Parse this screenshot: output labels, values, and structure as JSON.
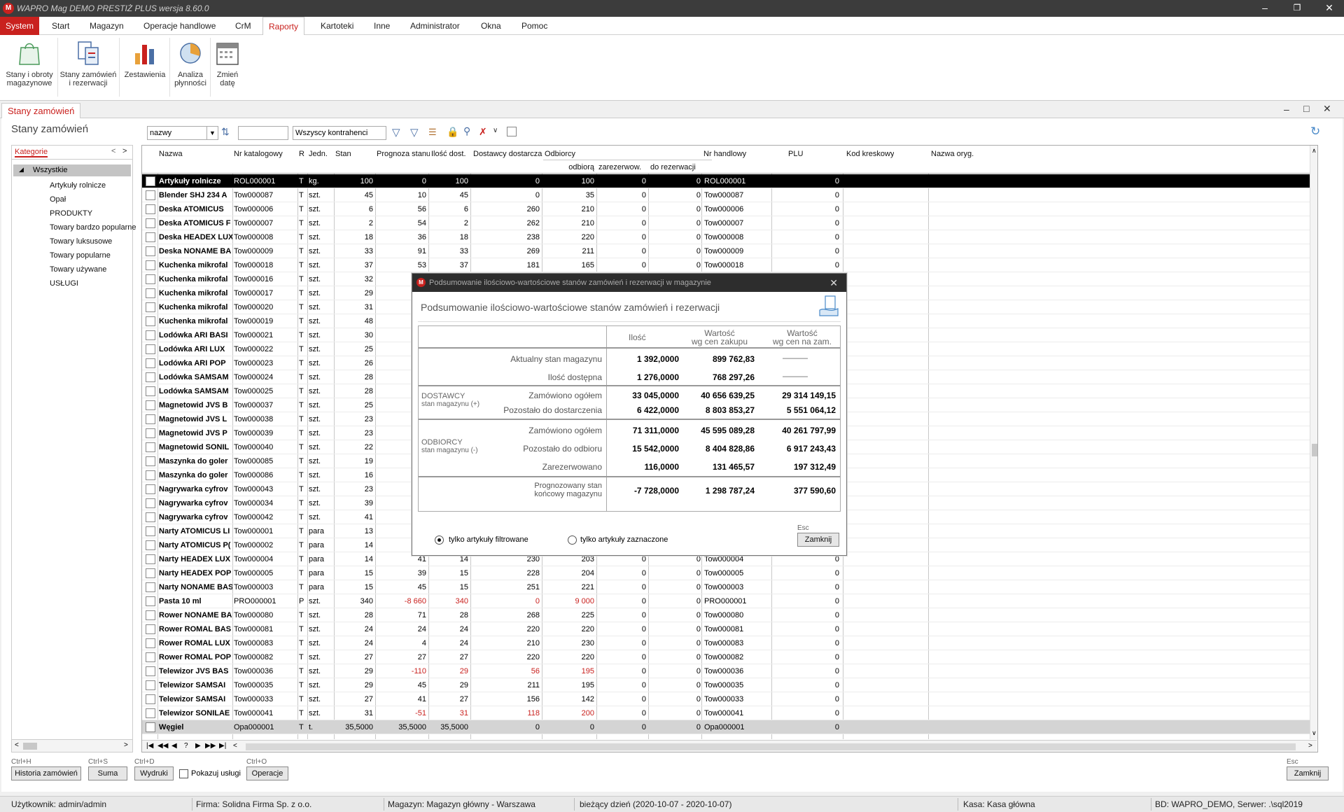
{
  "window": {
    "title": "WAPRO Mag DEMO PRESTIŻ PLUS  wersja 8.60.0"
  },
  "menu": [
    "System",
    "Start",
    "Magazyn",
    "Operacje handlowe",
    "CrM",
    "Raporty",
    "Kartoteki",
    "Inne",
    "Administrator",
    "Okna",
    "Pomoc"
  ],
  "ribbon": [
    {
      "label1": "Stany i obroty",
      "label2": "magazynowe",
      "icon": "shopping-bag-icon"
    },
    {
      "label1": "Stany zamówień",
      "label2": "i rezerwacji",
      "icon": "documents-icon"
    },
    {
      "label1": "Zestawienia",
      "label2": "",
      "icon": "bar-chart-icon"
    },
    {
      "label1": "Analiza",
      "label2": "płynności",
      "icon": "pie-chart-icon"
    },
    {
      "label1": "Zmień",
      "label2": "datę",
      "icon": "calendar-icon"
    }
  ],
  "doc_tab": "Stany zamówień",
  "page_title": "Stany zamówień",
  "filters": {
    "sort_field": "nazwy",
    "search_value": "",
    "contractor": "Wszyscy kontrahenci"
  },
  "categories": {
    "tab": "Kategorie",
    "root": "Wszystkie",
    "items": [
      "Artykuły rolnicze",
      "Opał",
      "PRODUKTY",
      "Towary bardzo popularne",
      "Towary luksusowe",
      "Towary popularne",
      "Towary używane",
      "USŁUGI"
    ]
  },
  "grid": {
    "headers": {
      "nazwa": "Nazwa",
      "nr_kat": "Nr katalogowy",
      "r": "R",
      "jedn": "Jedn.",
      "stan": "Stan",
      "prognoza": "Prognoza stanu",
      "ilosc_dost": "Ilość dost.",
      "dostawcy": "Dostawcy dostarcza",
      "odbiorcy": "Odbiorcy",
      "odbiora": "odbiorą",
      "zarezerwow": "zarezerwow.",
      "do_rezerwacji": "do rezerwacji",
      "nr_handlowy": "Nr handlowy",
      "plu": "PLU",
      "kod": "Kod kreskowy",
      "nazwa_oryg": "Nazwa oryg."
    },
    "rows": [
      {
        "n": "Artykuły rolnicze",
        "k": "ROL000001",
        "r": "T",
        "j": "kg.",
        "s": "100",
        "p": "0",
        "i": "100",
        "d": "0",
        "o": "100",
        "z": "0",
        "dr": "0",
        "h": "ROL000001",
        "plu": "0",
        "sel": true
      },
      {
        "n": "Blender SHJ 234 A",
        "k": "Tow000087",
        "r": "T",
        "j": "szt.",
        "s": "45",
        "p": "10",
        "i": "45",
        "d": "0",
        "o": "35",
        "z": "0",
        "dr": "0",
        "h": "Tow000087",
        "plu": "0"
      },
      {
        "n": "Deska ATOMICUS",
        "k": "Tow000006",
        "r": "T",
        "j": "szt.",
        "s": "6",
        "p": "56",
        "i": "6",
        "d": "260",
        "o": "210",
        "z": "0",
        "dr": "0",
        "h": "Tow000006",
        "plu": "0"
      },
      {
        "n": "Deska ATOMICUS F",
        "k": "Tow000007",
        "r": "T",
        "j": "szt.",
        "s": "2",
        "p": "54",
        "i": "2",
        "d": "262",
        "o": "210",
        "z": "0",
        "dr": "0",
        "h": "Tow000007",
        "plu": "0"
      },
      {
        "n": "Deska HEADEX LUX",
        "k": "Tow000008",
        "r": "T",
        "j": "szt.",
        "s": "18",
        "p": "36",
        "i": "18",
        "d": "238",
        "o": "220",
        "z": "0",
        "dr": "0",
        "h": "Tow000008",
        "plu": "0"
      },
      {
        "n": "Deska NONAME BA",
        "k": "Tow000009",
        "r": "T",
        "j": "szt.",
        "s": "33",
        "p": "91",
        "i": "33",
        "d": "269",
        "o": "211",
        "z": "0",
        "dr": "0",
        "h": "Tow000009",
        "plu": "0"
      },
      {
        "n": "Kuchenka mikrofal",
        "k": "Tow000018",
        "r": "T",
        "j": "szt.",
        "s": "37",
        "p": "53",
        "i": "37",
        "d": "181",
        "o": "165",
        "z": "0",
        "dr": "0",
        "h": "Tow000018",
        "plu": "0"
      },
      {
        "n": "Kuchenka mikrofal",
        "k": "Tow000016",
        "r": "T",
        "j": "szt.",
        "s": "32",
        "p": "",
        "i": "",
        "d": "",
        "o": "",
        "z": "",
        "dr": "",
        "h": "",
        "plu": ""
      },
      {
        "n": "Kuchenka mikrofal",
        "k": "Tow000017",
        "r": "T",
        "j": "szt.",
        "s": "29",
        "p": "",
        "i": "",
        "d": "",
        "o": "",
        "z": "",
        "dr": "",
        "h": "",
        "plu": ""
      },
      {
        "n": "Kuchenka mikrofal",
        "k": "Tow000020",
        "r": "T",
        "j": "szt.",
        "s": "31",
        "p": "",
        "i": "",
        "d": "",
        "o": "",
        "z": "",
        "dr": "",
        "h": "",
        "plu": ""
      },
      {
        "n": "Kuchenka mikrofal",
        "k": "Tow000019",
        "r": "T",
        "j": "szt.",
        "s": "48",
        "p": "",
        "i": "",
        "d": "",
        "o": "",
        "z": "",
        "dr": "",
        "h": "",
        "plu": ""
      },
      {
        "n": "Lodówka ARI BASI",
        "k": "Tow000021",
        "r": "T",
        "j": "szt.",
        "s": "30",
        "p": "",
        "i": "",
        "d": "",
        "o": "",
        "z": "",
        "dr": "",
        "h": "",
        "plu": ""
      },
      {
        "n": "Lodówka ARI LUX",
        "k": "Tow000022",
        "r": "T",
        "j": "szt.",
        "s": "25",
        "p": "",
        "i": "",
        "d": "",
        "o": "",
        "z": "",
        "dr": "",
        "h": "",
        "plu": ""
      },
      {
        "n": "Lodówka ARI POP",
        "k": "Tow000023",
        "r": "T",
        "j": "szt.",
        "s": "26",
        "p": "",
        "i": "",
        "d": "",
        "o": "",
        "z": "",
        "dr": "",
        "h": "",
        "plu": ""
      },
      {
        "n": "Lodówka SAMSAM",
        "k": "Tow000024",
        "r": "T",
        "j": "szt.",
        "s": "28",
        "p": "",
        "i": "",
        "d": "",
        "o": "",
        "z": "",
        "dr": "",
        "h": "",
        "plu": ""
      },
      {
        "n": "Lodówka SAMSAM",
        "k": "Tow000025",
        "r": "T",
        "j": "szt.",
        "s": "28",
        "p": "",
        "i": "",
        "d": "",
        "o": "",
        "z": "",
        "dr": "",
        "h": "",
        "plu": ""
      },
      {
        "n": "Magnetowid JVS B",
        "k": "Tow000037",
        "r": "T",
        "j": "szt.",
        "s": "25",
        "p": "",
        "i": "",
        "d": "",
        "o": "",
        "z": "",
        "dr": "",
        "h": "",
        "plu": ""
      },
      {
        "n": "Magnetowid JVS L",
        "k": "Tow000038",
        "r": "T",
        "j": "szt.",
        "s": "23",
        "p": "",
        "i": "",
        "d": "",
        "o": "",
        "z": "",
        "dr": "",
        "h": "",
        "plu": ""
      },
      {
        "n": "Magnetowid JVS P",
        "k": "Tow000039",
        "r": "T",
        "j": "szt.",
        "s": "23",
        "p": "",
        "i": "",
        "d": "",
        "o": "",
        "z": "",
        "dr": "",
        "h": "",
        "plu": ""
      },
      {
        "n": "Magnetowid SONIL",
        "k": "Tow000040",
        "r": "T",
        "j": "szt.",
        "s": "22",
        "p": "",
        "i": "",
        "d": "",
        "o": "",
        "z": "",
        "dr": "",
        "h": "",
        "plu": ""
      },
      {
        "n": "Maszynka do goler",
        "k": "Tow000085",
        "r": "T",
        "j": "szt.",
        "s": "19",
        "p": "",
        "i": "",
        "d": "",
        "o": "",
        "z": "",
        "dr": "",
        "h": "",
        "plu": ""
      },
      {
        "n": "Maszynka do goler",
        "k": "Tow000086",
        "r": "T",
        "j": "szt.",
        "s": "16",
        "p": "",
        "i": "",
        "d": "",
        "o": "",
        "z": "",
        "dr": "",
        "h": "",
        "plu": ""
      },
      {
        "n": "Nagrywarka cyfrov",
        "k": "Tow000043",
        "r": "T",
        "j": "szt.",
        "s": "23",
        "p": "",
        "i": "",
        "d": "",
        "o": "",
        "z": "",
        "dr": "",
        "h": "",
        "plu": ""
      },
      {
        "n": "Nagrywarka cyfrov",
        "k": "Tow000034",
        "r": "T",
        "j": "szt.",
        "s": "39",
        "p": "",
        "i": "",
        "d": "",
        "o": "",
        "z": "",
        "dr": "",
        "h": "",
        "plu": ""
      },
      {
        "n": "Nagrywarka cyfrov",
        "k": "Tow000042",
        "r": "T",
        "j": "szt.",
        "s": "41",
        "p": "",
        "i": "",
        "d": "",
        "o": "",
        "z": "",
        "dr": "",
        "h": "",
        "plu": ""
      },
      {
        "n": "Narty ATOMICUS LI",
        "k": "Tow000001",
        "r": "T",
        "j": "para",
        "s": "13",
        "p": "",
        "i": "",
        "d": "",
        "o": "",
        "z": "",
        "dr": "",
        "h": "",
        "plu": ""
      },
      {
        "n": "Narty ATOMICUS P(",
        "k": "Tow000002",
        "r": "T",
        "j": "para",
        "s": "14",
        "p": "",
        "i": "",
        "d": "",
        "o": "",
        "z": "",
        "dr": "",
        "h": "",
        "plu": ""
      },
      {
        "n": "Narty HEADEX LUX",
        "k": "Tow000004",
        "r": "T",
        "j": "para",
        "s": "14",
        "p": "41",
        "i": "14",
        "d": "230",
        "o": "203",
        "z": "0",
        "dr": "0",
        "h": "Tow000004",
        "plu": "0"
      },
      {
        "n": "Narty HEADEX POP",
        "k": "Tow000005",
        "r": "T",
        "j": "para",
        "s": "15",
        "p": "39",
        "i": "15",
        "d": "228",
        "o": "204",
        "z": "0",
        "dr": "0",
        "h": "Tow000005",
        "plu": "0"
      },
      {
        "n": "Narty NONAME BAS",
        "k": "Tow000003",
        "r": "T",
        "j": "para",
        "s": "15",
        "p": "45",
        "i": "15",
        "d": "251",
        "o": "221",
        "z": "0",
        "dr": "0",
        "h": "Tow000003",
        "plu": "0"
      },
      {
        "n": "Pasta 10 ml",
        "k": "PRO000001",
        "r": "P",
        "j": "szt.",
        "s": "340",
        "p": "-8 660",
        "i": "340",
        "d": "0",
        "o": "9 000",
        "z": "0",
        "dr": "0",
        "h": "PRO000001",
        "plu": "0",
        "red": true
      },
      {
        "n": "Rower NONAME BA",
        "k": "Tow000080",
        "r": "T",
        "j": "szt.",
        "s": "28",
        "p": "71",
        "i": "28",
        "d": "268",
        "o": "225",
        "z": "0",
        "dr": "0",
        "h": "Tow000080",
        "plu": "0"
      },
      {
        "n": "Rower ROMAL BAS",
        "k": "Tow000081",
        "r": "T",
        "j": "szt.",
        "s": "24",
        "p": "24",
        "i": "24",
        "d": "220",
        "o": "220",
        "z": "0",
        "dr": "0",
        "h": "Tow000081",
        "plu": "0"
      },
      {
        "n": "Rower ROMAL LUX",
        "k": "Tow000083",
        "r": "T",
        "j": "szt.",
        "s": "24",
        "p": "4",
        "i": "24",
        "d": "210",
        "o": "230",
        "z": "0",
        "dr": "0",
        "h": "Tow000083",
        "plu": "0"
      },
      {
        "n": "Rower ROMAL POP",
        "k": "Tow000082",
        "r": "T",
        "j": "szt.",
        "s": "27",
        "p": "27",
        "i": "27",
        "d": "220",
        "o": "220",
        "z": "0",
        "dr": "0",
        "h": "Tow000082",
        "plu": "0"
      },
      {
        "n": "Telewizor JVS BAS",
        "k": "Tow000036",
        "r": "T",
        "j": "szt.",
        "s": "29",
        "p": "-110",
        "i": "29",
        "d": "56",
        "o": "195",
        "z": "0",
        "dr": "0",
        "h": "Tow000036",
        "plu": "0",
        "red": true
      },
      {
        "n": "Telewizor SAMSAI",
        "k": "Tow000035",
        "r": "T",
        "j": "szt.",
        "s": "29",
        "p": "45",
        "i": "29",
        "d": "211",
        "o": "195",
        "z": "0",
        "dr": "0",
        "h": "Tow000035",
        "plu": "0"
      },
      {
        "n": "Telewizor SAMSAI",
        "k": "Tow000033",
        "r": "T",
        "j": "szt.",
        "s": "27",
        "p": "41",
        "i": "27",
        "d": "156",
        "o": "142",
        "z": "0",
        "dr": "0",
        "h": "Tow000033",
        "plu": "0"
      },
      {
        "n": "Telewizor SONILAE",
        "k": "Tow000041",
        "r": "T",
        "j": "szt.",
        "s": "31",
        "p": "-51",
        "i": "31",
        "d": "118",
        "o": "200",
        "z": "0",
        "dr": "0",
        "h": "Tow000041",
        "plu": "0",
        "red": true
      },
      {
        "n": "Węgiel",
        "k": "Opa000001",
        "r": "T",
        "j": "t.",
        "s": "35,5000",
        "p": "35,5000",
        "i": "35,5000",
        "d": "0",
        "o": "0",
        "z": "0",
        "dr": "0",
        "h": "Opa000001",
        "plu": "0",
        "last": true
      }
    ]
  },
  "modal": {
    "title": "Podsumowanie ilościowo-wartościowe stanów zamówień i rezerwacji w magazynie",
    "heading": "Podsumowanie ilościowo-wartościowe stanów zamówień i rezerwacji",
    "col_ilosc": "Ilość",
    "col_zak1": "Wartość",
    "col_zak2": "wg cen zakupu",
    "col_zam1": "Wartość",
    "col_zam2": "wg cen na zam.",
    "aktualny": {
      "label": "Aktualny stan magazynu",
      "ilosc": "1 392,0000",
      "zakup": "899 762,83",
      "zam": "———"
    },
    "dostepna": {
      "label": "Ilość dostępna",
      "ilosc": "1 276,0000",
      "zakup": "768 297,26",
      "zam": "———"
    },
    "dostawcy": {
      "name": "DOSTAWCY",
      "sub": "stan magazynu (+)",
      "zamowiono": {
        "label": "Zamówiono ogółem",
        "ilosc": "33 045,0000",
        "zakup": "40 656 639,25",
        "zam": "29 314 149,15"
      },
      "pozostalo": {
        "label": "Pozostało do dostarczenia",
        "ilosc": "6 422,0000",
        "zakup": "8 803 853,27",
        "zam": "5 551 064,12"
      }
    },
    "odbiorcy": {
      "name": "ODBIORCY",
      "sub": "stan magazynu (-)",
      "zamowiono": {
        "label": "Zamówiono ogółem",
        "ilosc": "71 311,0000",
        "zakup": "45 595 089,28",
        "zam": "40 261 797,99"
      },
      "pozostalo": {
        "label": "Pozostało do odbioru",
        "ilosc": "15 542,0000",
        "zakup": "8 404 828,86",
        "zam": "6 917 243,43"
      },
      "zarezerwowano": {
        "label": "Zarezerwowano",
        "ilosc": "116,0000",
        "zakup": "131 465,57",
        "zam": "197 312,49"
      }
    },
    "prognoza": {
      "label1": "Prognozowany stan",
      "label2": "końcowy magazynu",
      "ilosc": "-7 728,0000",
      "zakup": "1 298 787,24",
      "zam": "377 590,60"
    },
    "radio1": "tylko artykuły filtrowane",
    "radio2": "tylko artykuły zaznaczone",
    "esc": "Esc",
    "close": "Zamknij"
  },
  "bottom": {
    "historia": {
      "hint": "Ctrl+H",
      "label": "Historia zamówień"
    },
    "suma": {
      "hint": "Ctrl+S",
      "label": "Suma"
    },
    "wydruki": {
      "hint": "Ctrl+D",
      "label": "Wydruki"
    },
    "pokazuj": "Pokazuj usługi",
    "operacje": {
      "hint": "Ctrl+O",
      "label": "Operacje"
    },
    "zamknij": {
      "hint": "Esc",
      "label": "Zamknij"
    }
  },
  "status": {
    "user": "Użytkownik: admin/admin",
    "firma": "Firma: Solidna Firma Sp. z o.o.",
    "magazyn": "Magazyn: Magazyn główny - Warszawa",
    "dzien": "bieżący dzień (2020-10-07 - 2020-10-07)",
    "kasa": "Kasa: Kasa główna",
    "bd": "BD: WAPRO_DEMO, Serwer: .\\sql2019"
  },
  "colors": {
    "accent": "#c9211e",
    "selected_row": "#000000",
    "titlebar": "#3c3c3c"
  }
}
